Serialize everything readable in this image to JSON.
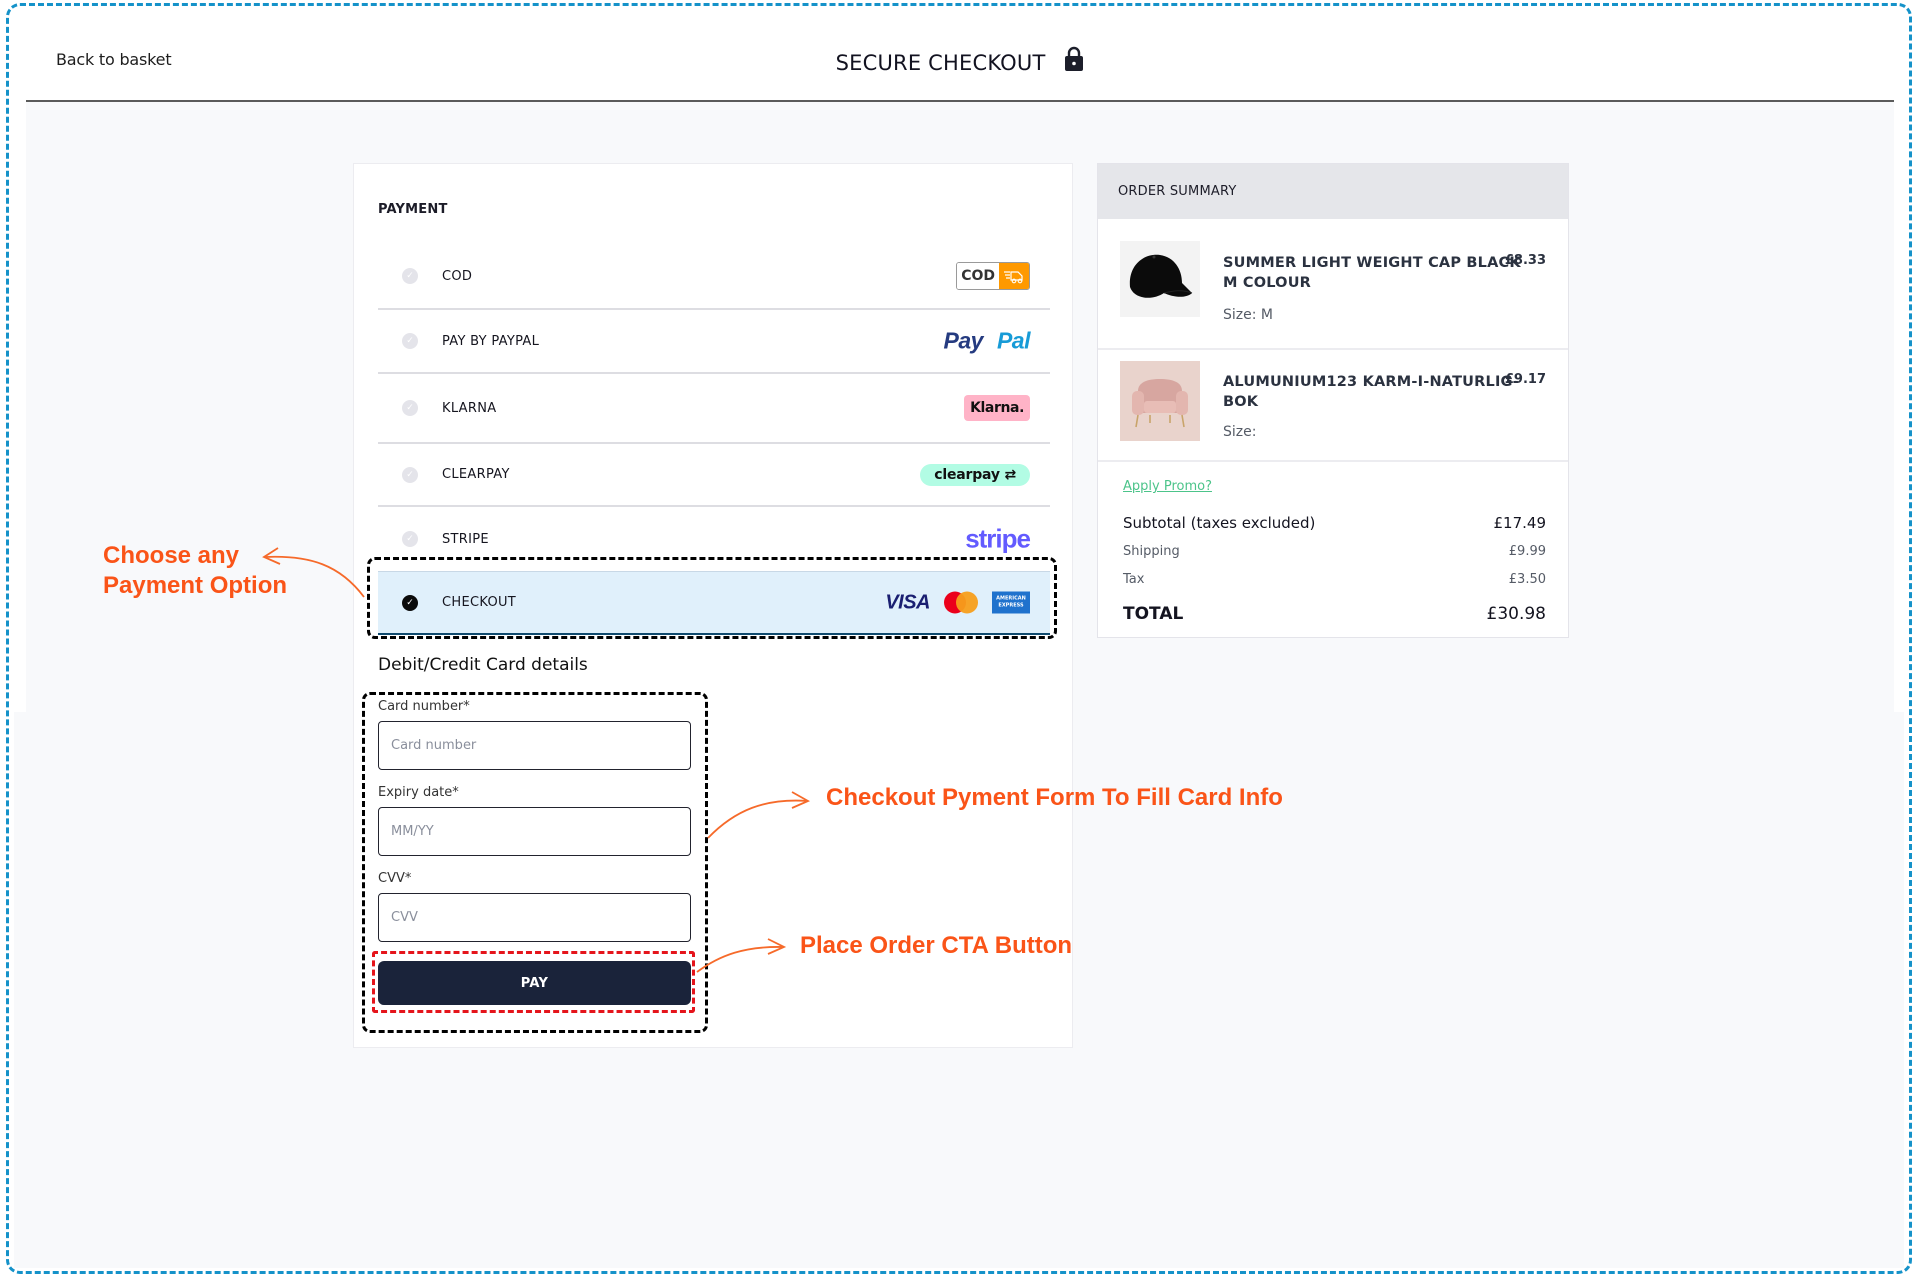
{
  "header": {
    "back_link": "Back to basket",
    "title": "SECURE CHECKOUT",
    "lock_icon": "lock-icon"
  },
  "payment": {
    "heading": "PAYMENT",
    "methods": [
      {
        "label": "COD",
        "logo": "cod-logo",
        "logo_text": "COD",
        "selected": false
      },
      {
        "label": "PAY BY PAYPAL",
        "logo": "paypal-logo",
        "logo_text_1": "Pay",
        "logo_text_2": "Pal",
        "selected": false
      },
      {
        "label": "KLARNA",
        "logo": "klarna-logo",
        "logo_text": "Klarna.",
        "selected": false
      },
      {
        "label": "CLEARPAY",
        "logo": "clearpay-logo",
        "logo_text": "clearpay",
        "selected": false
      },
      {
        "label": "STRIPE",
        "logo": "stripe-logo",
        "logo_text": "stripe",
        "selected": false
      },
      {
        "label": "CHECKOUT",
        "logo": "card-brands",
        "logo_visa": "VISA",
        "logo_amex": "AMERICAN EXPRESS",
        "selected": true
      }
    ],
    "card_details": {
      "heading": "Debit/Credit Card details",
      "card_number": {
        "label": "Card number*",
        "placeholder": "Card number",
        "value": ""
      },
      "expiry": {
        "label": "Expiry date*",
        "placeholder": "MM/YY",
        "value": ""
      },
      "cvv": {
        "label": "CVV*",
        "placeholder": "CVV",
        "value": ""
      },
      "pay_button": "PAY"
    }
  },
  "annotations": {
    "choose_payment": "Choose any\nPayment Option",
    "choose_payment_line1": "Choose any",
    "choose_payment_line2": "Payment Option",
    "checkout_form": "Checkout Pyment Form To Fill Card Info",
    "place_order": "Place Order CTA Button"
  },
  "order_summary": {
    "heading": "ORDER SUMMARY",
    "items": [
      {
        "name": "SUMMER LIGHT WEIGHT CAP BLACK M COLOUR",
        "size": "Size: M",
        "price": "£8.33",
        "image": "black-cap"
      },
      {
        "name": "ALUMUNIUM123 KARM-I-NATURLIG-BOK",
        "size": "Size:",
        "price": "£9.17",
        "image": "pink-armchair"
      }
    ],
    "promo_link": "Apply Promo?",
    "subtotal_label": "Subtotal (taxes excluded)",
    "subtotal_value": "£17.49",
    "shipping_label": "Shipping",
    "shipping_value": "£9.99",
    "tax_label": "Tax",
    "tax_value": "£3.50",
    "total_label": "TOTAL",
    "total_value": "£30.98"
  },
  "colors": {
    "annotation_orange": "#fa5418",
    "frame_blue": "#1592c9",
    "selected_row_bg": "#e0f0fb",
    "pay_button": "#1a233a",
    "promo_green": "#4cc48a"
  }
}
